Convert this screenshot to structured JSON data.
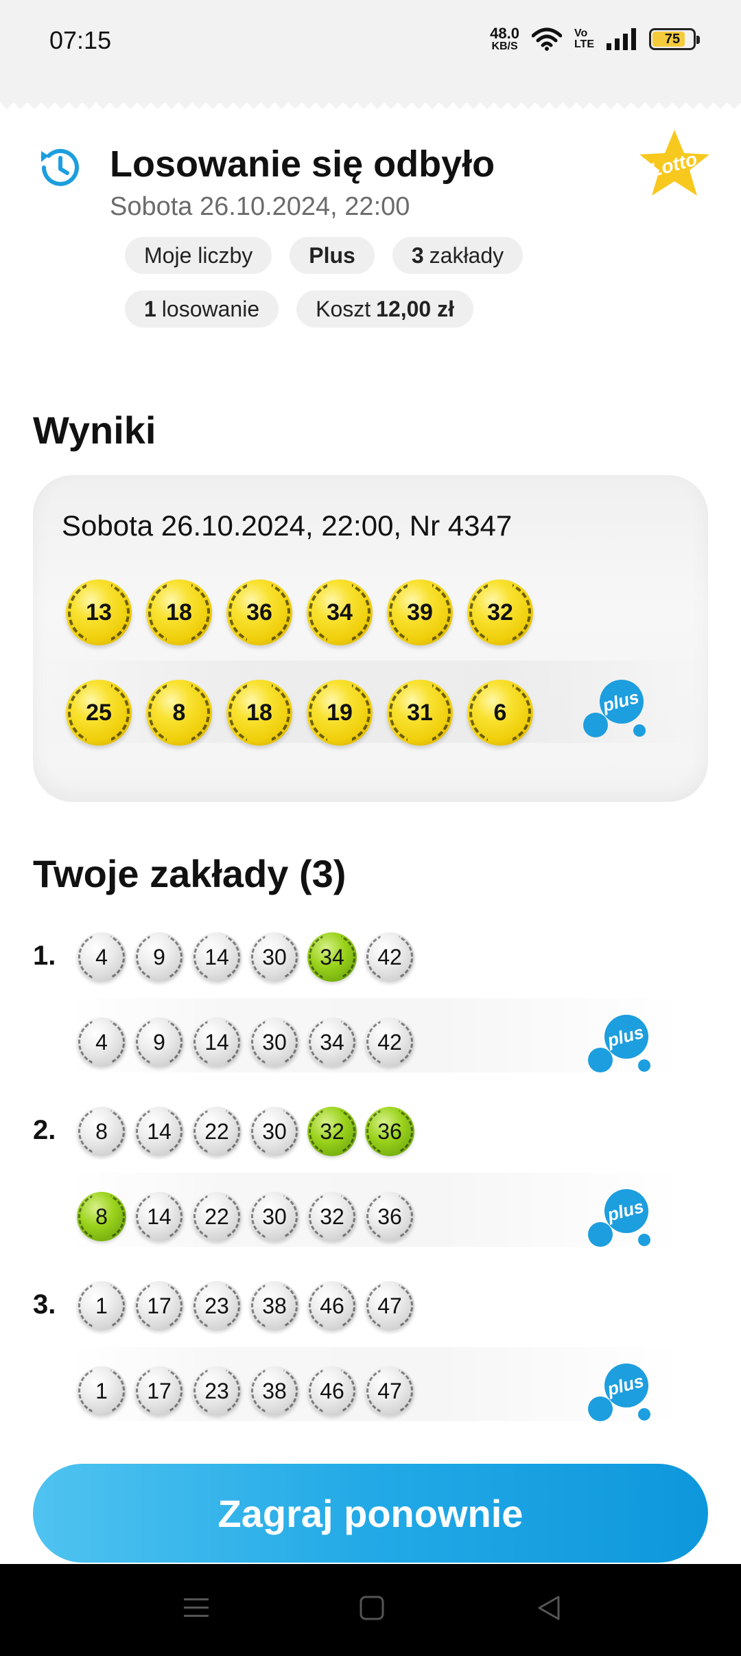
{
  "status": {
    "time": "07:15",
    "speed_value": "48.0",
    "speed_unit": "KB/S",
    "volte_top": "Vo",
    "volte_bottom": "LTE",
    "battery": "75"
  },
  "header": {
    "title": "Losowanie się odbyło",
    "subtitle": "Sobota 26.10.2024, 22:00",
    "badge_text": "Lotto",
    "chips": {
      "my_numbers": "Moje liczby",
      "plus": "Plus",
      "bets_count": "3",
      "bets_label": "zakłady",
      "draws_count": "1",
      "draws_label": "losowanie",
      "cost_label": "Koszt",
      "cost_value": "12,00 zł"
    }
  },
  "results": {
    "section_title": "Wyniki",
    "draw_label": "Sobota 26.10.2024, 22:00, Nr 4347",
    "lotto_numbers": [
      "13",
      "18",
      "36",
      "34",
      "39",
      "32"
    ],
    "plus_numbers": [
      "25",
      "8",
      "18",
      "19",
      "31",
      "6"
    ],
    "plus_logo_text": "plus"
  },
  "bets": {
    "section_title": "Twoje zakłady (3)",
    "items": [
      {
        "index": "1.",
        "lotto": [
          "4",
          "9",
          "14",
          "30",
          "34",
          "42"
        ],
        "lotto_hits": [
          false,
          false,
          false,
          false,
          true,
          false
        ],
        "plus": [
          "4",
          "9",
          "14",
          "30",
          "34",
          "42"
        ],
        "plus_hits": [
          false,
          false,
          false,
          false,
          false,
          false
        ]
      },
      {
        "index": "2.",
        "lotto": [
          "8",
          "14",
          "22",
          "30",
          "32",
          "36"
        ],
        "lotto_hits": [
          false,
          false,
          false,
          false,
          true,
          true
        ],
        "plus": [
          "8",
          "14",
          "22",
          "30",
          "32",
          "36"
        ],
        "plus_hits": [
          true,
          false,
          false,
          false,
          false,
          false
        ]
      },
      {
        "index": "3.",
        "lotto": [
          "1",
          "17",
          "23",
          "38",
          "46",
          "47"
        ],
        "lotto_hits": [
          false,
          false,
          false,
          false,
          false,
          false
        ],
        "plus": [
          "1",
          "17",
          "23",
          "38",
          "46",
          "47"
        ],
        "plus_hits": [
          false,
          false,
          false,
          false,
          false,
          false
        ]
      }
    ]
  },
  "cta": {
    "label": "Zagraj ponownie"
  },
  "colors": {
    "accent": "#22a9e6",
    "ball_yellow": "#f9e231",
    "hit_green": "#9bd31c",
    "plus_blue": "#1d9ede",
    "badge_yellow": "#f7c81e"
  },
  "icons": {
    "history": "history-icon",
    "home": "home-icon",
    "back": "back-icon",
    "menu": "menu-icon"
  }
}
